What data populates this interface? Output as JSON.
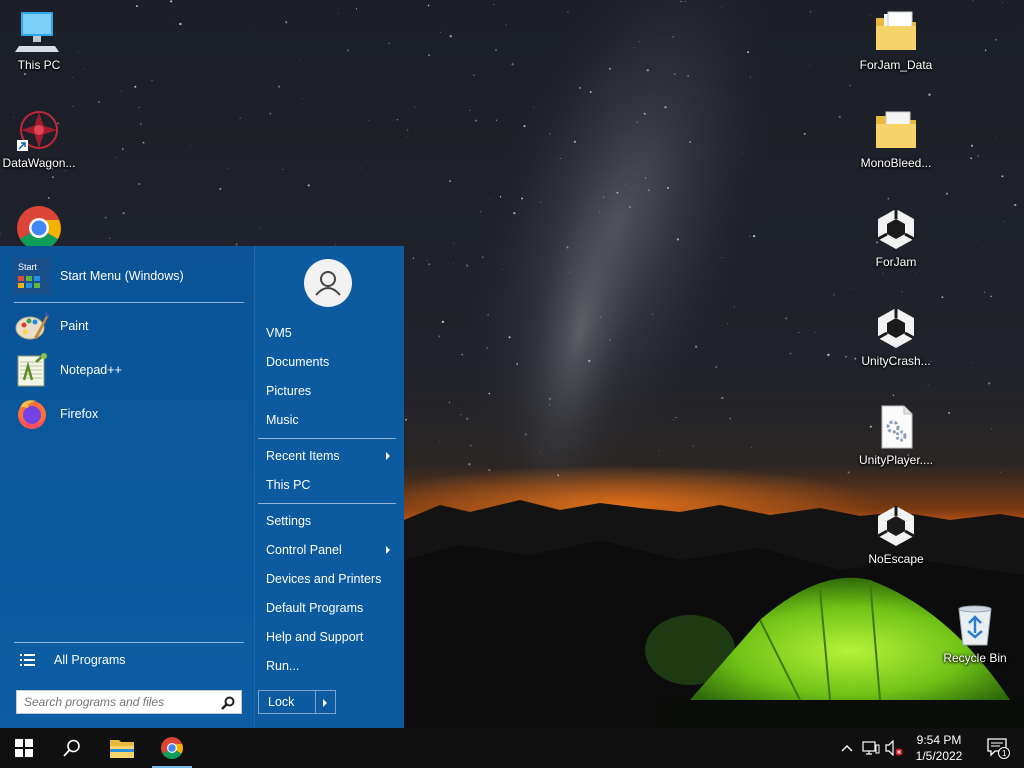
{
  "desktop": {
    "icons_left": [
      {
        "label": "This PC",
        "icon": "this-pc-icon"
      },
      {
        "label": "DataWagon...",
        "icon": "datawagon-icon"
      },
      {
        "label": "",
        "icon": "chrome-icon"
      }
    ],
    "icons_right": [
      {
        "label": "ForJam_Data",
        "icon": "folder-icon"
      },
      {
        "label": "MonoBleed...",
        "icon": "folder-icon"
      },
      {
        "label": "ForJam",
        "icon": "unity-icon"
      },
      {
        "label": "UnityCrash...",
        "icon": "unity-icon"
      },
      {
        "label": "UnityPlayer....",
        "icon": "dll-file-icon"
      },
      {
        "label": "NoEscape",
        "icon": "unity-icon"
      },
      {
        "label": "Recycle Bin",
        "icon": "recycle-bin-icon"
      }
    ]
  },
  "start_menu": {
    "header_item": {
      "label": "Start Menu (Windows)",
      "icon_text": "Start"
    },
    "programs": [
      {
        "label": "Paint",
        "icon": "paint-icon"
      },
      {
        "label": "Notepad++",
        "icon": "notepadpp-icon"
      },
      {
        "label": "Firefox",
        "icon": "firefox-icon"
      }
    ],
    "all_programs": "All Programs",
    "search_placeholder": "Search programs and files",
    "right_group1": [
      "VM5",
      "Documents",
      "Pictures",
      "Music"
    ],
    "right_group2": [
      {
        "label": "Recent Items",
        "submenu": true
      },
      {
        "label": "This PC",
        "submenu": false
      }
    ],
    "right_group3": [
      {
        "label": "Settings",
        "submenu": false
      },
      {
        "label": "Control Panel",
        "submenu": true
      },
      {
        "label": "Devices and Printers",
        "submenu": false
      },
      {
        "label": "Default Programs",
        "submenu": false
      },
      {
        "label": "Help and Support",
        "submenu": false
      },
      {
        "label": "Run...",
        "submenu": false
      }
    ],
    "lock_label": "Lock"
  },
  "taskbar": {
    "clock_time": "9:54 PM",
    "clock_date": "1/5/2022",
    "notification_count": "1"
  },
  "colors": {
    "start_menu_bg": "#0c5aa0",
    "taskbar_bg": "#101010",
    "accent": "#76b9ed"
  }
}
